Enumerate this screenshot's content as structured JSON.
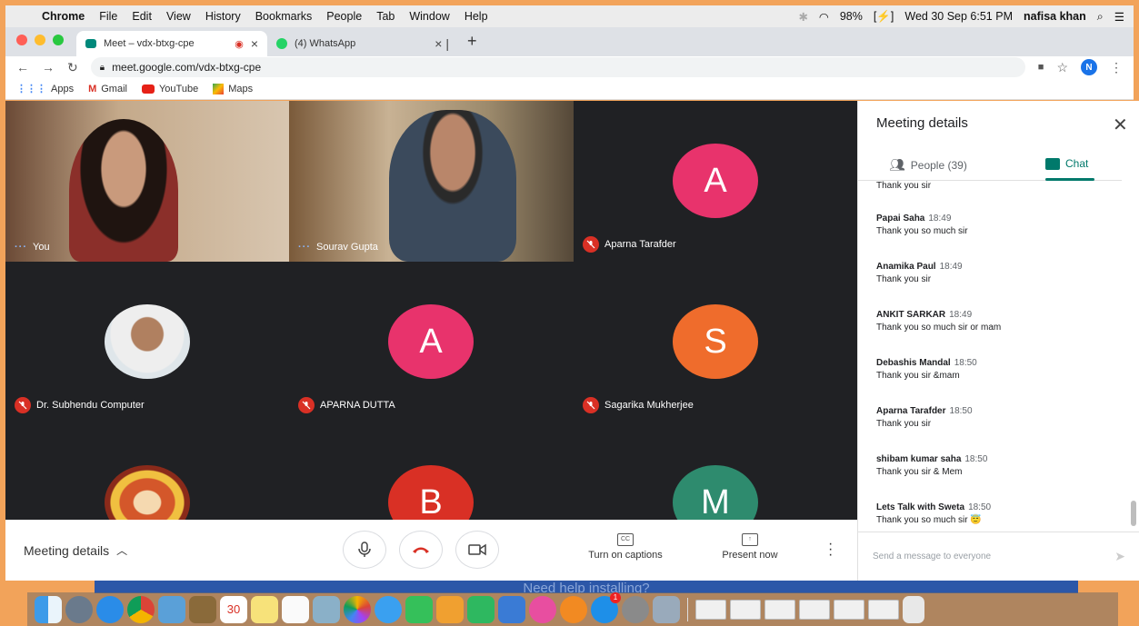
{
  "menubar": {
    "app": "Chrome",
    "items": [
      "File",
      "Edit",
      "View",
      "History",
      "Bookmarks",
      "People",
      "Tab",
      "Window",
      "Help"
    ],
    "battery": "98%",
    "datetime": "Wed 30 Sep  6:51 PM",
    "user": "nafisa khan"
  },
  "tabs": [
    {
      "title": "Meet – vdx-btxg-cpe",
      "active": true
    },
    {
      "title": "(4) WhatsApp",
      "active": false
    }
  ],
  "toolbar": {
    "url": "meet.google.com/vdx-btxg-cpe",
    "profile_initial": "N"
  },
  "bookmarks": [
    "Apps",
    "Gmail",
    "YouTube",
    "Maps"
  ],
  "participants": [
    {
      "name": "You",
      "initial": "",
      "color": ""
    },
    {
      "name": "Sourav Gupta",
      "initial": "",
      "color": ""
    },
    {
      "name": "Aparna Tarafder",
      "initial": "A",
      "color": "#e8336c"
    },
    {
      "name": "Dr. Subhendu Computer",
      "initial": "",
      "color": ""
    },
    {
      "name": "APARNA DUTTA",
      "initial": "A",
      "color": "#e8336c"
    },
    {
      "name": "Sagarika Mukherjee",
      "initial": "S",
      "color": "#ef6c2c"
    },
    {
      "name": "",
      "initial": "",
      "color": ""
    },
    {
      "name": "",
      "initial": "B",
      "color": "#d93025"
    },
    {
      "name": "",
      "initial": "M",
      "color": "#2e8b6e"
    }
  ],
  "bottombar": {
    "meeting_details": "Meeting details",
    "captions": "Turn on captions",
    "present": "Present now"
  },
  "panel": {
    "title": "Meeting details",
    "people_tab": "People (39)",
    "chat_tab": "Chat",
    "top_partial": "Thank you sir",
    "messages": [
      {
        "sender": "Papai Saha",
        "time": "18:49",
        "text": "Thank you so much sir"
      },
      {
        "sender": "Anamika Paul",
        "time": "18:49",
        "text": "Thank you sir"
      },
      {
        "sender": "ANKIT SARKAR",
        "time": "18:49",
        "text": "Thank you so much sir or mam"
      },
      {
        "sender": "Debashis Mandal",
        "time": "18:50",
        "text": "Thank you sir &mam"
      },
      {
        "sender": "Aparna Tarafder",
        "time": "18:50",
        "text": "Thank you sir"
      },
      {
        "sender": "shibam kumar saha",
        "time": "18:50",
        "text": "Thank you sir & Mem"
      },
      {
        "sender": "Lets Talk with Sweta",
        "time": "18:50",
        "text": "Thank you so much sir 😇"
      }
    ],
    "compose_placeholder": "Send a message to everyone"
  },
  "behind_text": "Need help installing?",
  "dock_badge": "1",
  "dock_calendar_day": "30"
}
